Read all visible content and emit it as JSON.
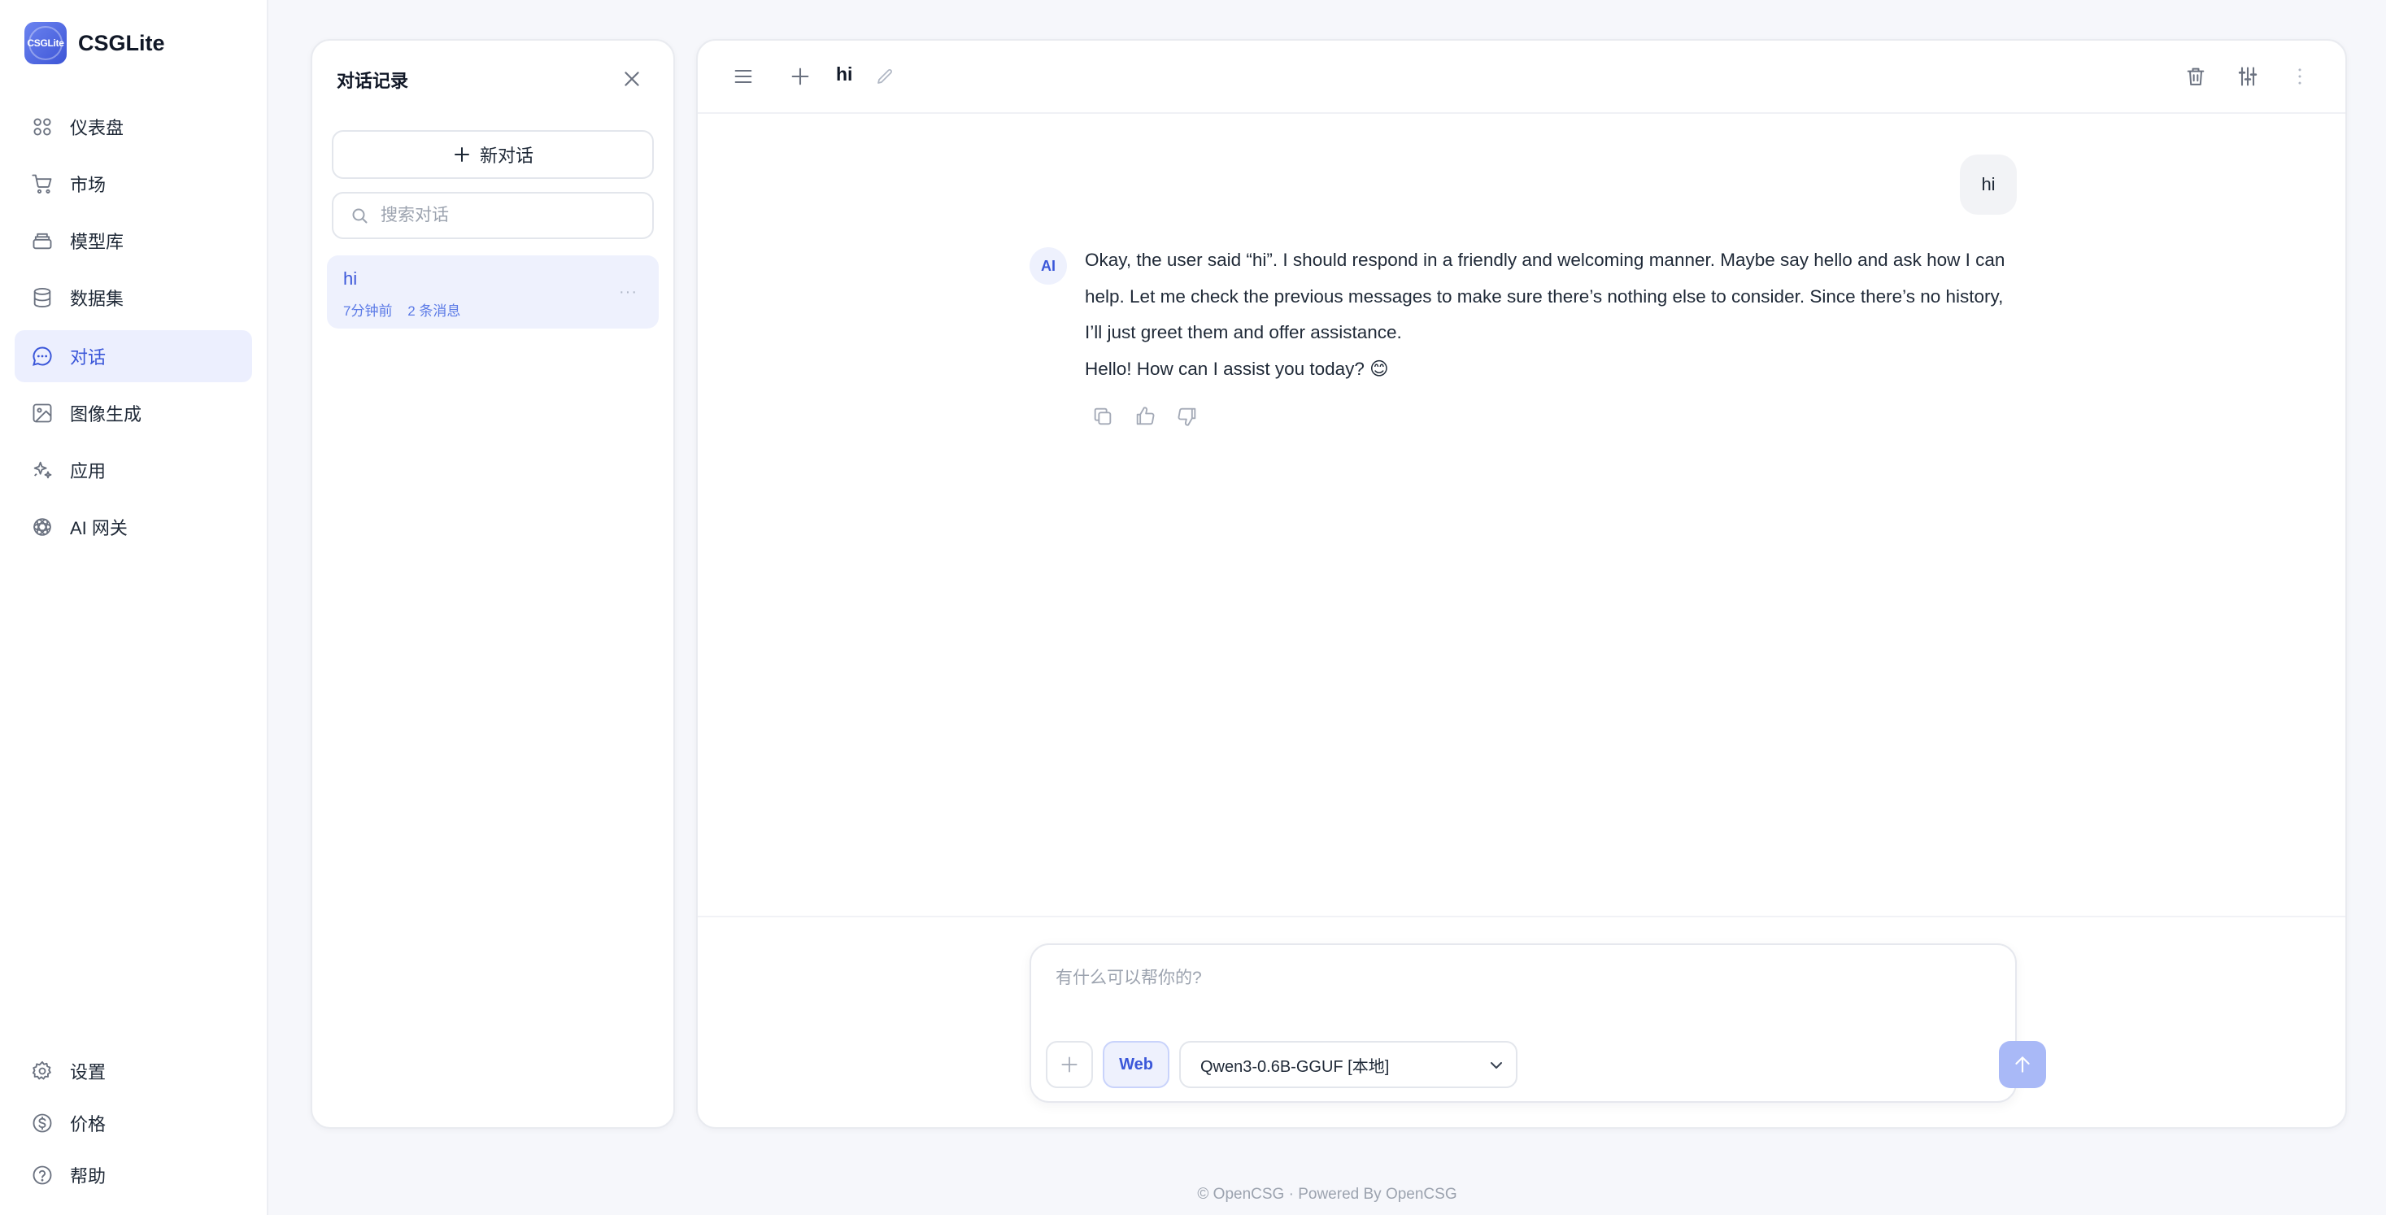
{
  "app": {
    "name": "CSGLite",
    "logo_text": "CSGLite"
  },
  "sidebar": {
    "items": [
      {
        "label": "仪表盘",
        "icon": "dashboard-grid-icon"
      },
      {
        "label": "市场",
        "icon": "cart-icon"
      },
      {
        "label": "模型库",
        "icon": "layers-icon"
      },
      {
        "label": "数据集",
        "icon": "database-icon"
      },
      {
        "label": "对话",
        "icon": "chat-bubble-icon",
        "active": true
      },
      {
        "label": "图像生成",
        "icon": "image-icon"
      },
      {
        "label": "应用",
        "icon": "sparkles-icon"
      },
      {
        "label": "AI 网关",
        "icon": "openai-knot-icon"
      }
    ],
    "bottom_items": [
      {
        "label": "设置",
        "icon": "gear-icon"
      },
      {
        "label": "价格",
        "icon": "dollar-circle-icon"
      },
      {
        "label": "帮助",
        "icon": "question-circle-icon"
      }
    ]
  },
  "history_panel": {
    "title": "对话记录",
    "new_chat_label": "新对话",
    "search_placeholder": "搜索对话",
    "conversations": [
      {
        "title": "hi",
        "time": "7分钟前",
        "count": "2 条消息"
      }
    ],
    "more_label": "···"
  },
  "chat": {
    "title": "hi",
    "messages": [
      {
        "role": "user",
        "text": "hi"
      },
      {
        "role": "assistant",
        "avatar": "AI",
        "thinking": "Okay, the user said “hi”. I should respond in a friendly and welcoming manner. Maybe say hello and ask how I can help. Let me check the previous messages to make sure there’s nothing else to consider. Since there’s no history, I’ll just greet them and offer assistance.",
        "reply": "Hello! How can I assist you today? 😊"
      }
    ],
    "composer": {
      "placeholder": "有什么可以帮你的?",
      "web_label": "Web",
      "model": "Qwen3-0.6B-GGUF [本地]"
    }
  },
  "footer": {
    "text": "© OpenCSG · Powered By OpenCSG"
  },
  "colors": {
    "accent": "#3b57d9",
    "active_bg": "#eceffe",
    "send_button": "#a9b9f7",
    "page_bg": "#f6f7fb"
  }
}
